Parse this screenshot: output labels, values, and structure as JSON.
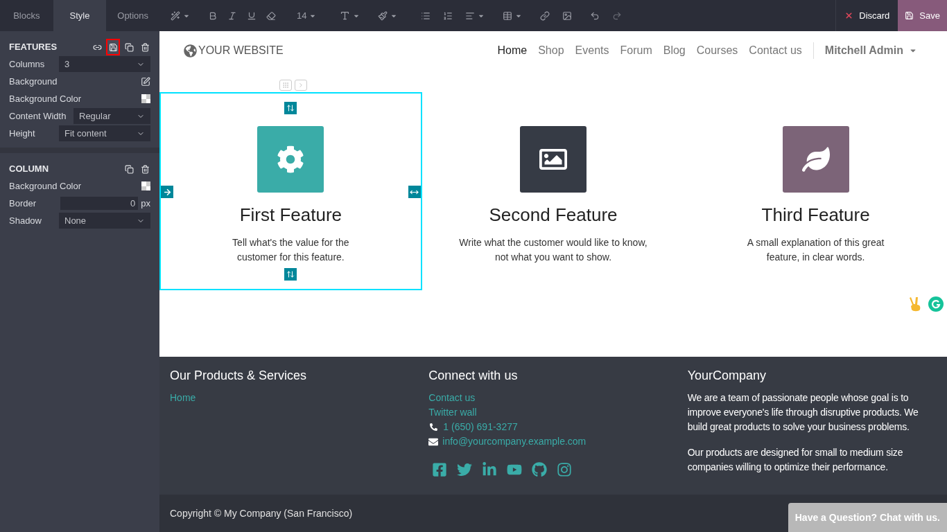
{
  "sidebar": {
    "tabs": [
      {
        "label": "Blocks",
        "selected": false
      },
      {
        "label": "Style",
        "selected": true
      },
      {
        "label": "Options",
        "selected": false
      }
    ],
    "sections": [
      {
        "title": "FEATURES",
        "actions": [
          {
            "kind": "link",
            "highlighted": false
          },
          {
            "kind": "save",
            "highlighted": true
          },
          {
            "kind": "duplicate",
            "highlighted": false
          },
          {
            "kind": "delete",
            "highlighted": false
          }
        ],
        "options": [
          {
            "kind": "select",
            "label": "Columns",
            "value": "3"
          },
          {
            "kind": "edit",
            "label": "Background"
          },
          {
            "kind": "swatch",
            "label": "Background Color"
          },
          {
            "kind": "select",
            "label": "Content Width",
            "value": "Regular"
          },
          {
            "kind": "select",
            "label": "Height",
            "value": "Fit content"
          }
        ]
      },
      {
        "title": "COLUMN",
        "actions": [
          {
            "kind": "duplicate",
            "highlighted": false
          },
          {
            "kind": "delete",
            "highlighted": false
          }
        ],
        "options": [
          {
            "kind": "swatch",
            "label": "Background Color"
          },
          {
            "kind": "number",
            "label": "Border",
            "value": "0",
            "unit": "px"
          },
          {
            "kind": "select",
            "label": "Shadow",
            "value": "None"
          }
        ]
      }
    ]
  },
  "toolbar": {
    "font_size": "14",
    "discard": "Discard",
    "save": "Save"
  },
  "site": {
    "logo": "YOUR WEBSITE",
    "nav": [
      {
        "label": "Home",
        "selected": true
      },
      {
        "label": "Shop",
        "selected": false
      },
      {
        "label": "Events",
        "selected": false
      },
      {
        "label": "Forum",
        "selected": false
      },
      {
        "label": "Blog",
        "selected": false
      },
      {
        "label": "Courses",
        "selected": false
      },
      {
        "label": "Contact us",
        "selected": false
      }
    ],
    "user": "Mitchell Admin"
  },
  "features": [
    {
      "color": "#3aaca8",
      "title": "First Feature",
      "text": "Tell what's the value for the customer for this feature.",
      "selected": true
    },
    {
      "color": "#363b45",
      "title": "Second Feature",
      "text": "Write what the customer would like to know, not what you want to show.",
      "selected": false
    },
    {
      "color": "#7c6478",
      "title": "Third Feature",
      "text": "A small explanation of this great feature, in clear words.",
      "selected": false
    }
  ],
  "footer": {
    "columns": [
      {
        "title": "Our Products & Services",
        "items": [
          {
            "kind": "link",
            "text": "Home"
          }
        ]
      },
      {
        "title": "Connect with us",
        "items": [
          {
            "kind": "link",
            "text": "Contact us"
          },
          {
            "kind": "link",
            "text": "Twitter wall"
          },
          {
            "kind": "phone",
            "text": "1 (650) 691-3277"
          },
          {
            "kind": "email",
            "text": "info@yourcompany.example.com"
          }
        ]
      },
      {
        "title": "YourCompany",
        "paragraphs": [
          "We are a team of passionate people whose goal is to improve everyone's life through disruptive products. We build great products to solve your business problems.",
          "Our products are designed for small to medium size companies willing to optimize their performance."
        ]
      }
    ]
  },
  "copyright": "Copyright © My Company (San Francisco)",
  "chat": "Have a Question? Chat with us."
}
